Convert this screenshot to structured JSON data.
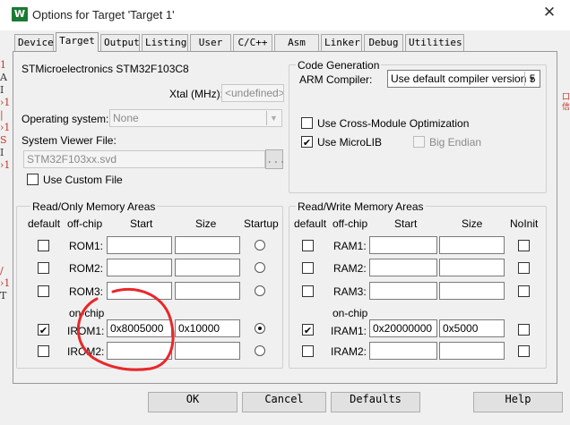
{
  "window": {
    "title": "Options for Target 'Target 1'",
    "app_icon_letter": "W",
    "close_glyph": "✕"
  },
  "tabs": [
    "Device",
    "Target",
    "Output",
    "Listing",
    "User",
    "C/C++",
    "Asm",
    "Linker",
    "Debug",
    "Utilities"
  ],
  "active_tab": "Target",
  "device": {
    "name": "STMicroelectronics STM32F103C8",
    "xtal_label": "Xtal (MHz):",
    "xtal_value": "<undefined>"
  },
  "os": {
    "label": "Operating system:",
    "value": "None"
  },
  "svd": {
    "label": "System Viewer File:",
    "value": "STM32F103xx.svd",
    "browse": "...",
    "custom_label": "Use Custom File"
  },
  "codegen": {
    "group_label": "Code Generation",
    "compiler_label": "ARM Compiler:",
    "compiler_value": "Use default compiler version 5",
    "cross_module": "Use Cross-Module Optimization",
    "microlib": "Use MicroLIB",
    "big_endian": "Big Endian"
  },
  "ro_memory": {
    "group_label": "Read/Only Memory Areas",
    "headers": {
      "default": "default",
      "offchip": "off-chip",
      "start": "Start",
      "size": "Size",
      "startup": "Startup"
    },
    "onchip_label": "on-chip",
    "rows": [
      {
        "name": "ROM1:",
        "start": "",
        "size": "",
        "default": false,
        "startup": false
      },
      {
        "name": "ROM2:",
        "start": "",
        "size": "",
        "default": false,
        "startup": false
      },
      {
        "name": "ROM3:",
        "start": "",
        "size": "",
        "default": false,
        "startup": false
      },
      {
        "name": "IROM1:",
        "start": "0x8005000",
        "size": "0x10000",
        "default": true,
        "startup": true
      },
      {
        "name": "IROM2:",
        "start": "",
        "size": "",
        "default": false,
        "startup": false
      }
    ]
  },
  "rw_memory": {
    "group_label": "Read/Write Memory Areas",
    "headers": {
      "default": "default",
      "offchip": "off-chip",
      "start": "Start",
      "size": "Size",
      "noinit": "NoInit"
    },
    "onchip_label": "on-chip",
    "rows": [
      {
        "name": "RAM1:",
        "start": "",
        "size": "",
        "default": false,
        "noinit": false
      },
      {
        "name": "RAM2:",
        "start": "",
        "size": "",
        "default": false,
        "noinit": false
      },
      {
        "name": "RAM3:",
        "start": "",
        "size": "",
        "default": false,
        "noinit": false
      },
      {
        "name": "IRAM1:",
        "start": "0x20000000",
        "size": "0x5000",
        "default": true,
        "noinit": false
      },
      {
        "name": "IRAM2:",
        "start": "",
        "size": "",
        "default": false,
        "noinit": false
      }
    ]
  },
  "buttons": {
    "ok": "OK",
    "cancel": "Cancel",
    "defaults": "Defaults",
    "help": "Help"
  },
  "check_glyph": "✔",
  "annotation_color": "#e8272a"
}
